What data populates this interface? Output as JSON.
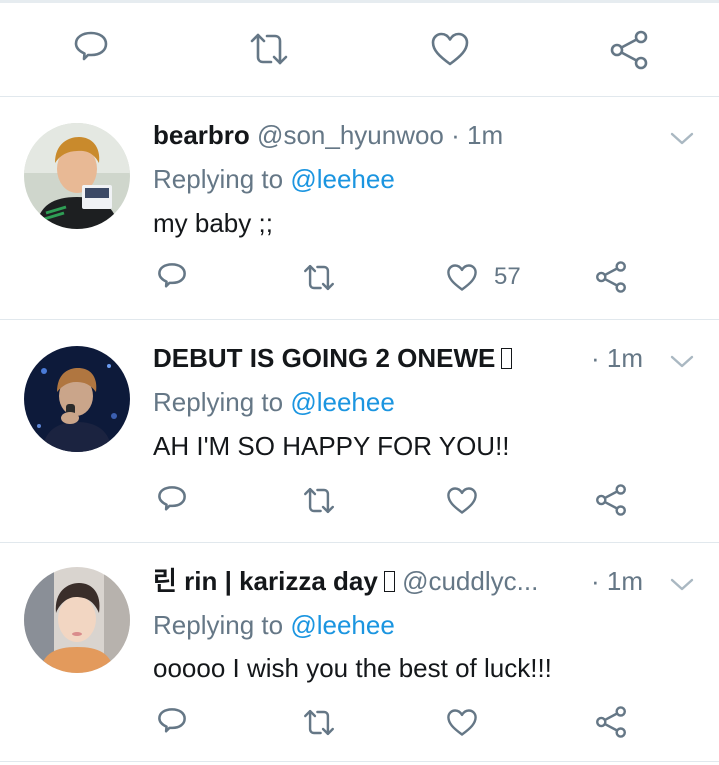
{
  "top_actions": {
    "reply_icon": "reply-icon",
    "retweet_icon": "retweet-icon",
    "like_icon": "heart-icon",
    "share_icon": "share-icon"
  },
  "replying_prefix": "Replying to",
  "replying_mention": "@leehee",
  "colors": {
    "text": "#14171a",
    "secondary": "#657786",
    "link": "#1b95e0",
    "divider": "#e1e8ed"
  },
  "tweets": [
    {
      "display_name": "bearbro",
      "handle": "@son_hyunwoo",
      "separator": "·",
      "time": "1m",
      "text": "my baby ;;",
      "like_count": "57"
    },
    {
      "display_name": "DEBUT IS GOING 2 ONEWE",
      "handle": "",
      "separator": "·",
      "time": "1m",
      "text": "AH I'M SO HAPPY FOR YOU!!",
      "like_count": ""
    },
    {
      "display_name": "린 rin | karizza day",
      "handle": "@cuddlyc...",
      "separator": "·",
      "time": "1m",
      "text": "ooooo I wish you the best of luck!!!",
      "like_count": ""
    }
  ]
}
